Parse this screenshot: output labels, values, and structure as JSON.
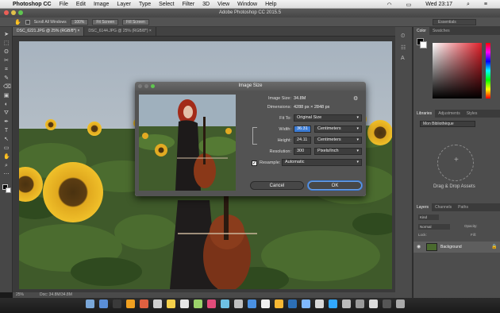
{
  "menubar": {
    "apple": "",
    "app": "Photoshop CC",
    "items": [
      "File",
      "Edit",
      "Image",
      "Layer",
      "Type",
      "Select",
      "Filter",
      "3D",
      "View",
      "Window",
      "Help"
    ],
    "clock": "Wed 23:17"
  },
  "window": {
    "title": "Adobe Photoshop CC 2015.5"
  },
  "options": {
    "scroll_all": "Scroll All Windows",
    "zoom": "100%",
    "fit_screen": "Fit Screen",
    "fill_screen": "Fill Screen",
    "workspace": "Essentials"
  },
  "tabs": [
    {
      "label": "DSC_6221.JPG @ 25% (RGB/8*)"
    },
    {
      "label": "DSC_6144.JPG @ 25% (RGB/8*)"
    }
  ],
  "status": {
    "zoom": "25%",
    "doc": "Doc: 34.8M/34.8M"
  },
  "panels": {
    "top_tabs": [
      "Color",
      "Swatches"
    ],
    "mid_tabs": [
      "Libraries",
      "Adjustments",
      "Styles"
    ],
    "library_name": "Mon Bibliothèque",
    "drop_text": "Drag & Drop Assets",
    "layer_tabs": [
      "Layers",
      "Channels",
      "Paths"
    ],
    "layer_kind": "Kind",
    "blend": "Normal",
    "opacity": "Opacity:",
    "lock": "Lock:",
    "fill": "Fill:",
    "layer_name": "Background"
  },
  "dialog": {
    "title": "Image Size",
    "image_size_label": "Image Size:",
    "image_size_value": "34.8M",
    "dimensions_label": "Dimensions:",
    "dimensions_value": "4288 px × 2848 px",
    "fit_to_label": "Fit To:",
    "fit_to_value": "Original Size",
    "width_label": "Width:",
    "width_value": "36.31",
    "width_unit": "Centimeters",
    "height_label": "Height:",
    "height_value": "24.11",
    "height_unit": "Centimeters",
    "resolution_label": "Resolution:",
    "resolution_value": "300",
    "resolution_unit": "Pixels/Inch",
    "resample_label": "Resample:",
    "resample_value": "Automatic",
    "cancel": "Cancel",
    "ok": "OK"
  },
  "colors": {
    "accent": "#3a7bd5",
    "picker_red": "#e0202a"
  },
  "icons": [
    "apple-icon",
    "gear-icon",
    "lock-icon",
    "eye-icon",
    "chain-link-icon",
    "cursor-icon"
  ]
}
